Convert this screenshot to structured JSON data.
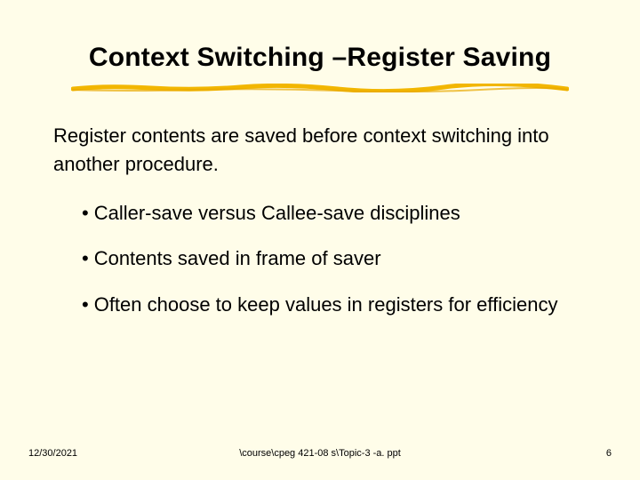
{
  "title": "Context Switching –Register Saving",
  "lead": "Register contents are saved before context switching into another procedure.",
  "bullets": [
    "Caller-save versus Callee-save disciplines",
    "Contents saved in frame of saver",
    "Often choose to keep values in registers for efficiency"
  ],
  "footer": {
    "date": "12/30/2021",
    "path": "\\course\\cpeg 421-08 s\\Topic-3 -a. ppt",
    "page": "6"
  },
  "colors": {
    "underline": "#f2b600",
    "background": "#fffde9"
  }
}
